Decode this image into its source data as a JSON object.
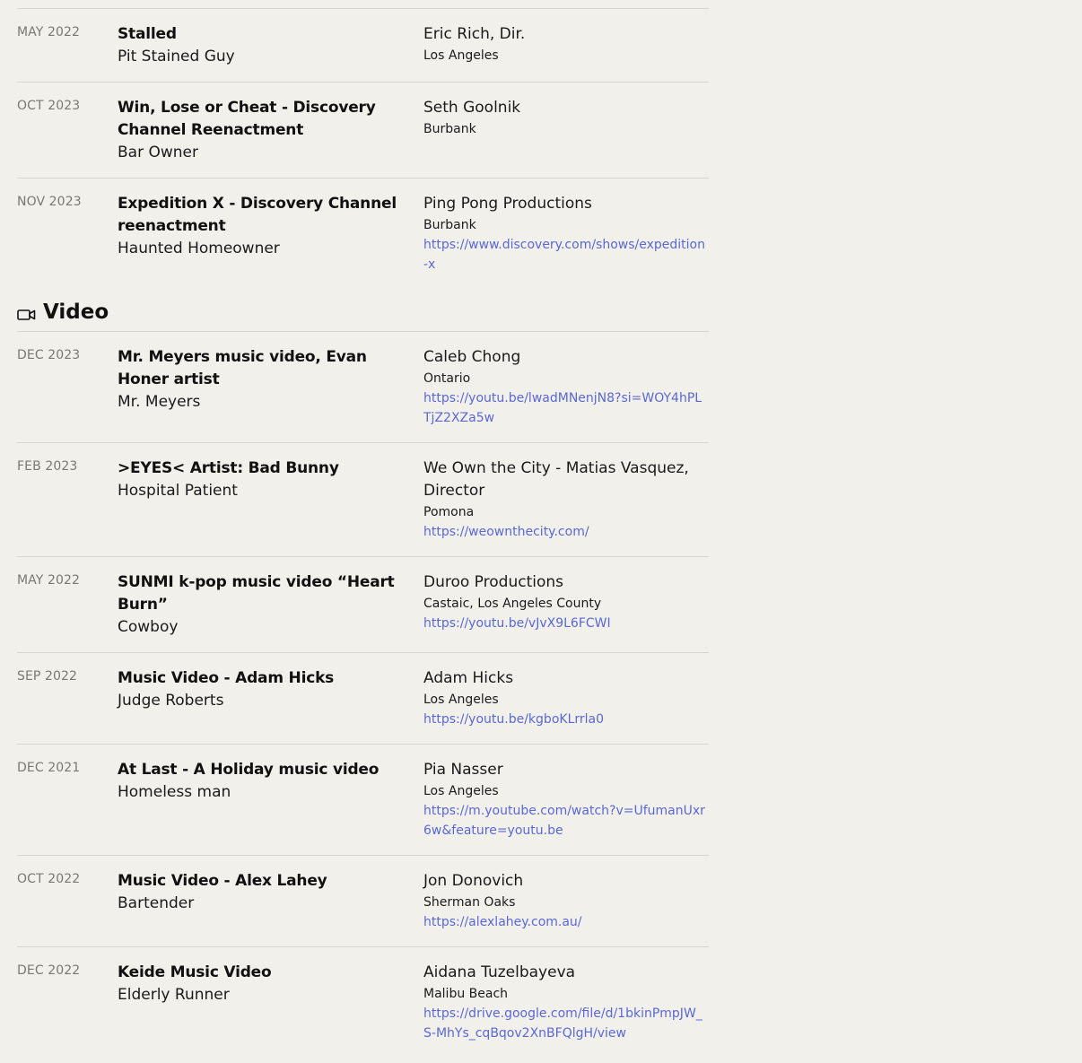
{
  "film_tail": [
    {
      "date": "MAY 2022",
      "title": "Stalled",
      "role": "Pit Stained Guy",
      "company": "Eric Rich, Dir.",
      "location": "Los Angeles",
      "link": ""
    },
    {
      "date": "OCT 2023",
      "title": "Win, Lose or Cheat - Discovery Channel Reenactment",
      "role": "Bar Owner",
      "company": "Seth Goolnik",
      "location": "Burbank",
      "link": ""
    },
    {
      "date": "NOV 2023",
      "title": "Expedition X - Discovery Channel reenactment",
      "role": "Haunted Homeowner",
      "company": "Ping Pong Productions",
      "location": "Burbank",
      "link": "https://www.discovery.com/shows/expedition-x"
    }
  ],
  "video_section": {
    "heading": "Video",
    "icon": "video-camera-icon",
    "entries": [
      {
        "date": "DEC 2023",
        "title": "Mr. Meyers music video, Evan Honer artist",
        "role": "Mr. Meyers",
        "company": "Caleb Chong",
        "location": "Ontario",
        "link": "https://youtu.be/lwadMNenjN8?si=WOY4hPLTjZ2XZa5w"
      },
      {
        "date": "FEB 2023",
        "title": ">EYES< Artist: Bad Bunny",
        "role": "Hospital Patient",
        "company": "We Own the City - Matias Vasquez, Director",
        "location": "Pomona",
        "link": "https://weownthecity.com/"
      },
      {
        "date": "MAY 2022",
        "title": "SUNMI k-pop music video “Heart Burn”",
        "role": "Cowboy",
        "company": "Duroo Productions",
        "location": "Castaic, Los Angeles County",
        "link": "https://youtu.be/vJvX9L6FCWI"
      },
      {
        "date": "SEP 2022",
        "title": "Music Video - Adam Hicks",
        "role": "Judge Roberts",
        "company": "Adam Hicks",
        "location": "Los Angeles",
        "link": "https://youtu.be/kgboKLrrla0"
      },
      {
        "date": "DEC 2021",
        "title": "At Last - A Holiday music video",
        "role": "Homeless man",
        "company": "Pia Nasser",
        "location": "Los Angeles",
        "link": "https://m.youtube.com/watch?v=UfumanUxr6w&feature=youtu.be"
      },
      {
        "date": "OCT 2022",
        "title": "Music Video - Alex Lahey",
        "role": "Bartender",
        "company": "Jon Donovich",
        "location": "Sherman Oaks",
        "link": "https://alexlahey.com.au/"
      },
      {
        "date": "DEC 2022",
        "title": "Keide Music Video",
        "role": "Elderly Runner",
        "company": "Aidana Tuzelbayeva",
        "location": "Malibu Beach",
        "link": "https://drive.google.com/file/d/1bkinPmpJW_S-MhYs_cqBqov2XnBFQlgH/view"
      }
    ]
  },
  "colors": {
    "background": "#f2f0eb",
    "link": "#5a68d6",
    "divider": "#d8d6d1",
    "date": "#7a7873"
  }
}
